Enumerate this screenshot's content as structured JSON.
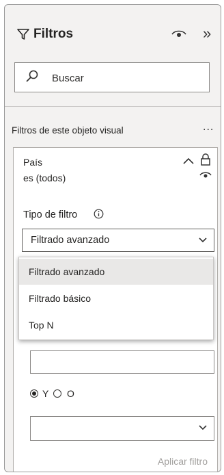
{
  "pane": {
    "title": "Filtros"
  },
  "search": {
    "placeholder": "Buscar"
  },
  "section": {
    "title": "Filtros de este objeto visual",
    "more": "..."
  },
  "filter_card": {
    "field": "País",
    "summary": "es (todos)",
    "type_label": "Tipo de filtro",
    "selected_type": "Filtrado avanzado",
    "options": [
      "Filtrado avanzado",
      "Filtrado básico",
      "Top N"
    ],
    "logic": {
      "and_label": "Y",
      "or_label": "O",
      "selected": "Y"
    },
    "apply_label": "Aplicar filtro"
  },
  "colors": {
    "pane_bg": "#f3f2f1",
    "border": "#8a8886",
    "disabled_text": "#a19f9d"
  },
  "icons": [
    "funnel-icon",
    "eye-icon",
    "collapse-pane-icon",
    "search-icon",
    "chevron-up-icon",
    "lock-icon",
    "info-icon",
    "chevron-down-icon"
  ]
}
